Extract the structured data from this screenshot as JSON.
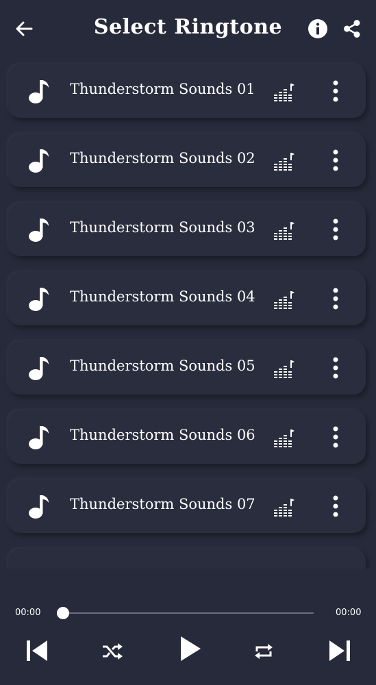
{
  "header": {
    "title": "Select Ringtone"
  },
  "ringtones": [
    {
      "label": "Thunderstorm Sounds 01"
    },
    {
      "label": "Thunderstorm Sounds 02"
    },
    {
      "label": "Thunderstorm Sounds 03"
    },
    {
      "label": "Thunderstorm Sounds 04"
    },
    {
      "label": "Thunderstorm Sounds 05"
    },
    {
      "label": "Thunderstorm Sounds 06"
    },
    {
      "label": "Thunderstorm Sounds 07"
    }
  ],
  "player": {
    "current_time": "00:00",
    "total_time": "00:00",
    "progress": 0
  },
  "icons": {
    "back": "arrow-left-icon",
    "info": "info-icon",
    "share": "share-icon",
    "note": "music-note-icon",
    "equalizer": "equalizer-icon",
    "more": "more-vertical-icon",
    "prev": "skip-previous-icon",
    "shuffle": "shuffle-icon",
    "play": "play-icon",
    "repeat": "repeat-icon",
    "next": "skip-next-icon"
  },
  "colors": {
    "background": "#262a3a",
    "card": "#292d3e",
    "foreground": "#ffffff",
    "track": "#6b6f80"
  }
}
